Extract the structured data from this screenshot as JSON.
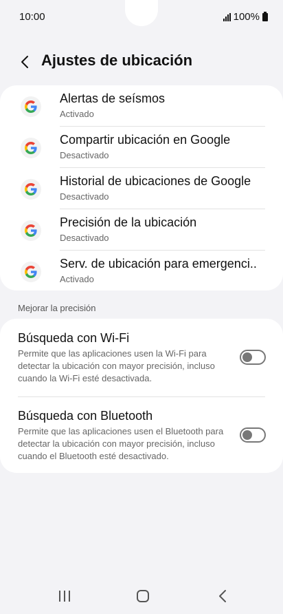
{
  "status": {
    "time": "10:00",
    "battery": "100%"
  },
  "header": {
    "title": "Ajustes de ubicación"
  },
  "apps": [
    {
      "title": "Alertas de seísmos",
      "status": "Activado"
    },
    {
      "title": "Compartir ubicación en Google",
      "status": "Desactivado"
    },
    {
      "title": "Historial de ubicaciones de Google",
      "status": "Desactivado"
    },
    {
      "title": "Precisión de la ubicación",
      "status": "Desactivado"
    },
    {
      "title": "Serv. de ubicación para emergenci..",
      "status": "Activado"
    }
  ],
  "section": {
    "label": "Mejorar la precisión"
  },
  "toggles": [
    {
      "title": "Búsqueda con Wi-Fi",
      "desc": "Permite que las aplicaciones usen la Wi-Fi para detectar la ubicación con mayor precisión, incluso cuando la Wi-Fi esté desactivada.",
      "on": false
    },
    {
      "title": "Búsqueda con Bluetooth",
      "desc": "Permite que las aplicaciones usen el Bluetooth para detectar la ubicación con mayor precisión, incluso cuando el Bluetooth esté desactivado.",
      "on": false
    }
  ],
  "colors": {
    "google_blue": "#4285F4",
    "google_red": "#EA4335",
    "google_yellow": "#FBBC05",
    "google_green": "#34A853",
    "switch_off": "#777777"
  }
}
